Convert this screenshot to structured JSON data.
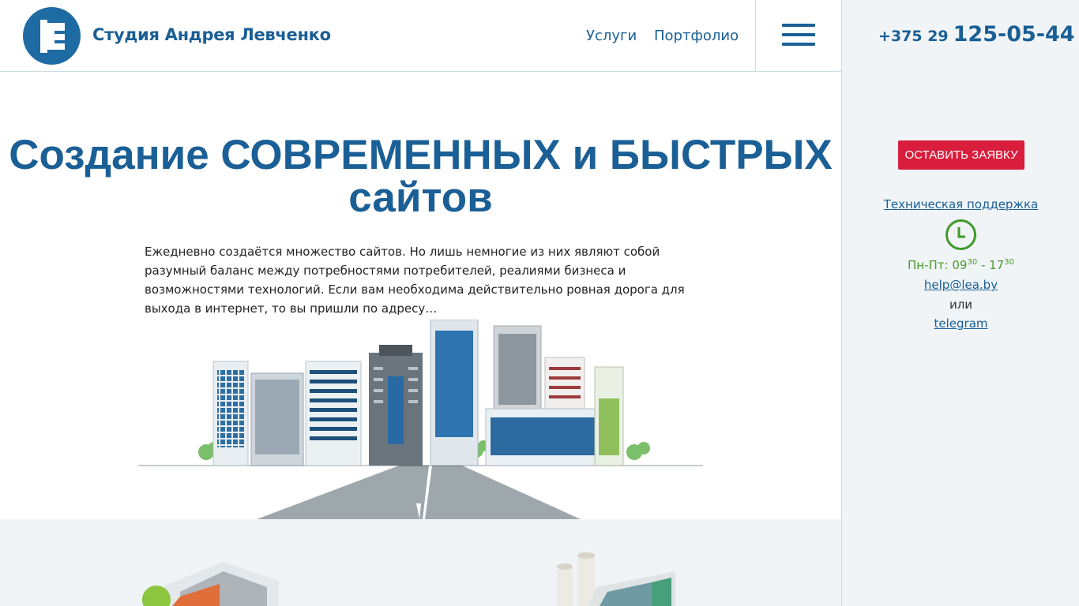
{
  "header": {
    "brand": "Студия Андрея Левченко",
    "nav": [
      "Услуги",
      "Портфолио"
    ],
    "phone_code": "+375 29",
    "phone_number": "125-05-44"
  },
  "hero": {
    "title_line1": "Создание СОВРЕМЕННЫХ и БЫСТРЫХ",
    "title_line2": "сайтов",
    "text": "Ежедневно создаётся множество сайтов. Но лишь немногие из них являют собой разумный баланс между потребностями потребителей, реалиями бизнеса и возможностями технологий. Если вам необходима действительно ровная дорога для выхода в интернет, то вы пришли по адресу…"
  },
  "sidebar": {
    "order_button": "ОСТАВИТЬ ЗАЯВКУ",
    "support_label": "Техническая поддержка",
    "hours_prefix": "Пн-Пт: 09",
    "hours_open_min": "30",
    "hours_sep": " - 17",
    "hours_close_min": "30",
    "email": "help@lea.by",
    "or": "или",
    "telegram": "telegram"
  },
  "colors": {
    "brand_blue": "#1a5f95",
    "accent_red": "#d81e3c",
    "hours_green": "#4a9a2a",
    "panel_bg": "#f0f4f7"
  }
}
